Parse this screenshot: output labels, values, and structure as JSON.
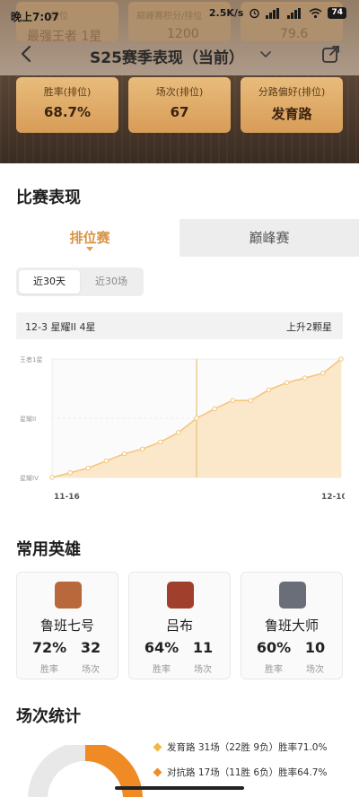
{
  "status_bar": {
    "time": "晚上7:07",
    "speed": "2.5K/s",
    "network_a": "HD",
    "network_b": "HD",
    "battery": "74"
  },
  "previous_season": [
    {
      "label": "段位",
      "value": "最强王者 1星"
    },
    {
      "label": "巅峰赛积分/排位",
      "value": "1200"
    },
    {
      "label": "",
      "value": "79.6"
    }
  ],
  "nav": {
    "title": "S25赛季表现（当前）"
  },
  "summary": [
    {
      "label": "胜率(排位)",
      "value": "68.7%"
    },
    {
      "label": "场次(排位)",
      "value": "67"
    },
    {
      "label": "分路偏好(排位)",
      "value": "发育路"
    }
  ],
  "performance": {
    "title": "比赛表现",
    "tabs": [
      "排位赛",
      "巅峰赛"
    ],
    "active_tab": "排位赛",
    "ranges": [
      "近30天",
      "近30场"
    ],
    "active_range": "近30天",
    "rank_info_left": "12-3 星耀II 4星",
    "rank_info_right": "上升2颗星"
  },
  "chart_data": {
    "type": "area",
    "y_ticks": [
      "王者1星",
      "星耀II",
      "星耀IV"
    ],
    "x_tick_labels": [
      "11-16",
      "12-10"
    ],
    "values": [
      0,
      0.04,
      0.08,
      0.14,
      0.2,
      0.24,
      0.3,
      0.38,
      0.5,
      0.58,
      0.65,
      0.65,
      0.74,
      0.8,
      0.84,
      0.88,
      1.0
    ],
    "ylim": [
      0,
      1
    ],
    "marker_index": 8,
    "grid": true,
    "color": "#f4c47a"
  },
  "heroes": {
    "title": "常用英雄",
    "list": [
      {
        "name": "鲁班七号",
        "win_rate": "72%",
        "games": "32",
        "win_label": "胜率",
        "games_label": "场次",
        "avatar_color": "#b8683a"
      },
      {
        "name": "吕布",
        "win_rate": "64%",
        "games": "11",
        "win_label": "胜率",
        "games_label": "场次",
        "avatar_color": "#a0402c"
      },
      {
        "name": "鲁班大师",
        "win_rate": "60%",
        "games": "10",
        "win_label": "胜率",
        "games_label": "场次",
        "avatar_color": "#6a6e78"
      }
    ]
  },
  "game_stats": {
    "title": "场次统计",
    "legend": [
      {
        "text": "发育路 31场（22胜 9负）胜率71.0%",
        "color": "#f2b840"
      },
      {
        "text": "对抗路 17场（11胜 6负）胜率64.7%",
        "color": "#f08a24"
      }
    ],
    "donut": [
      31,
      17
    ],
    "colors": {
      "primary": "#f08a24",
      "secondary": "#e8e8e8"
    }
  }
}
